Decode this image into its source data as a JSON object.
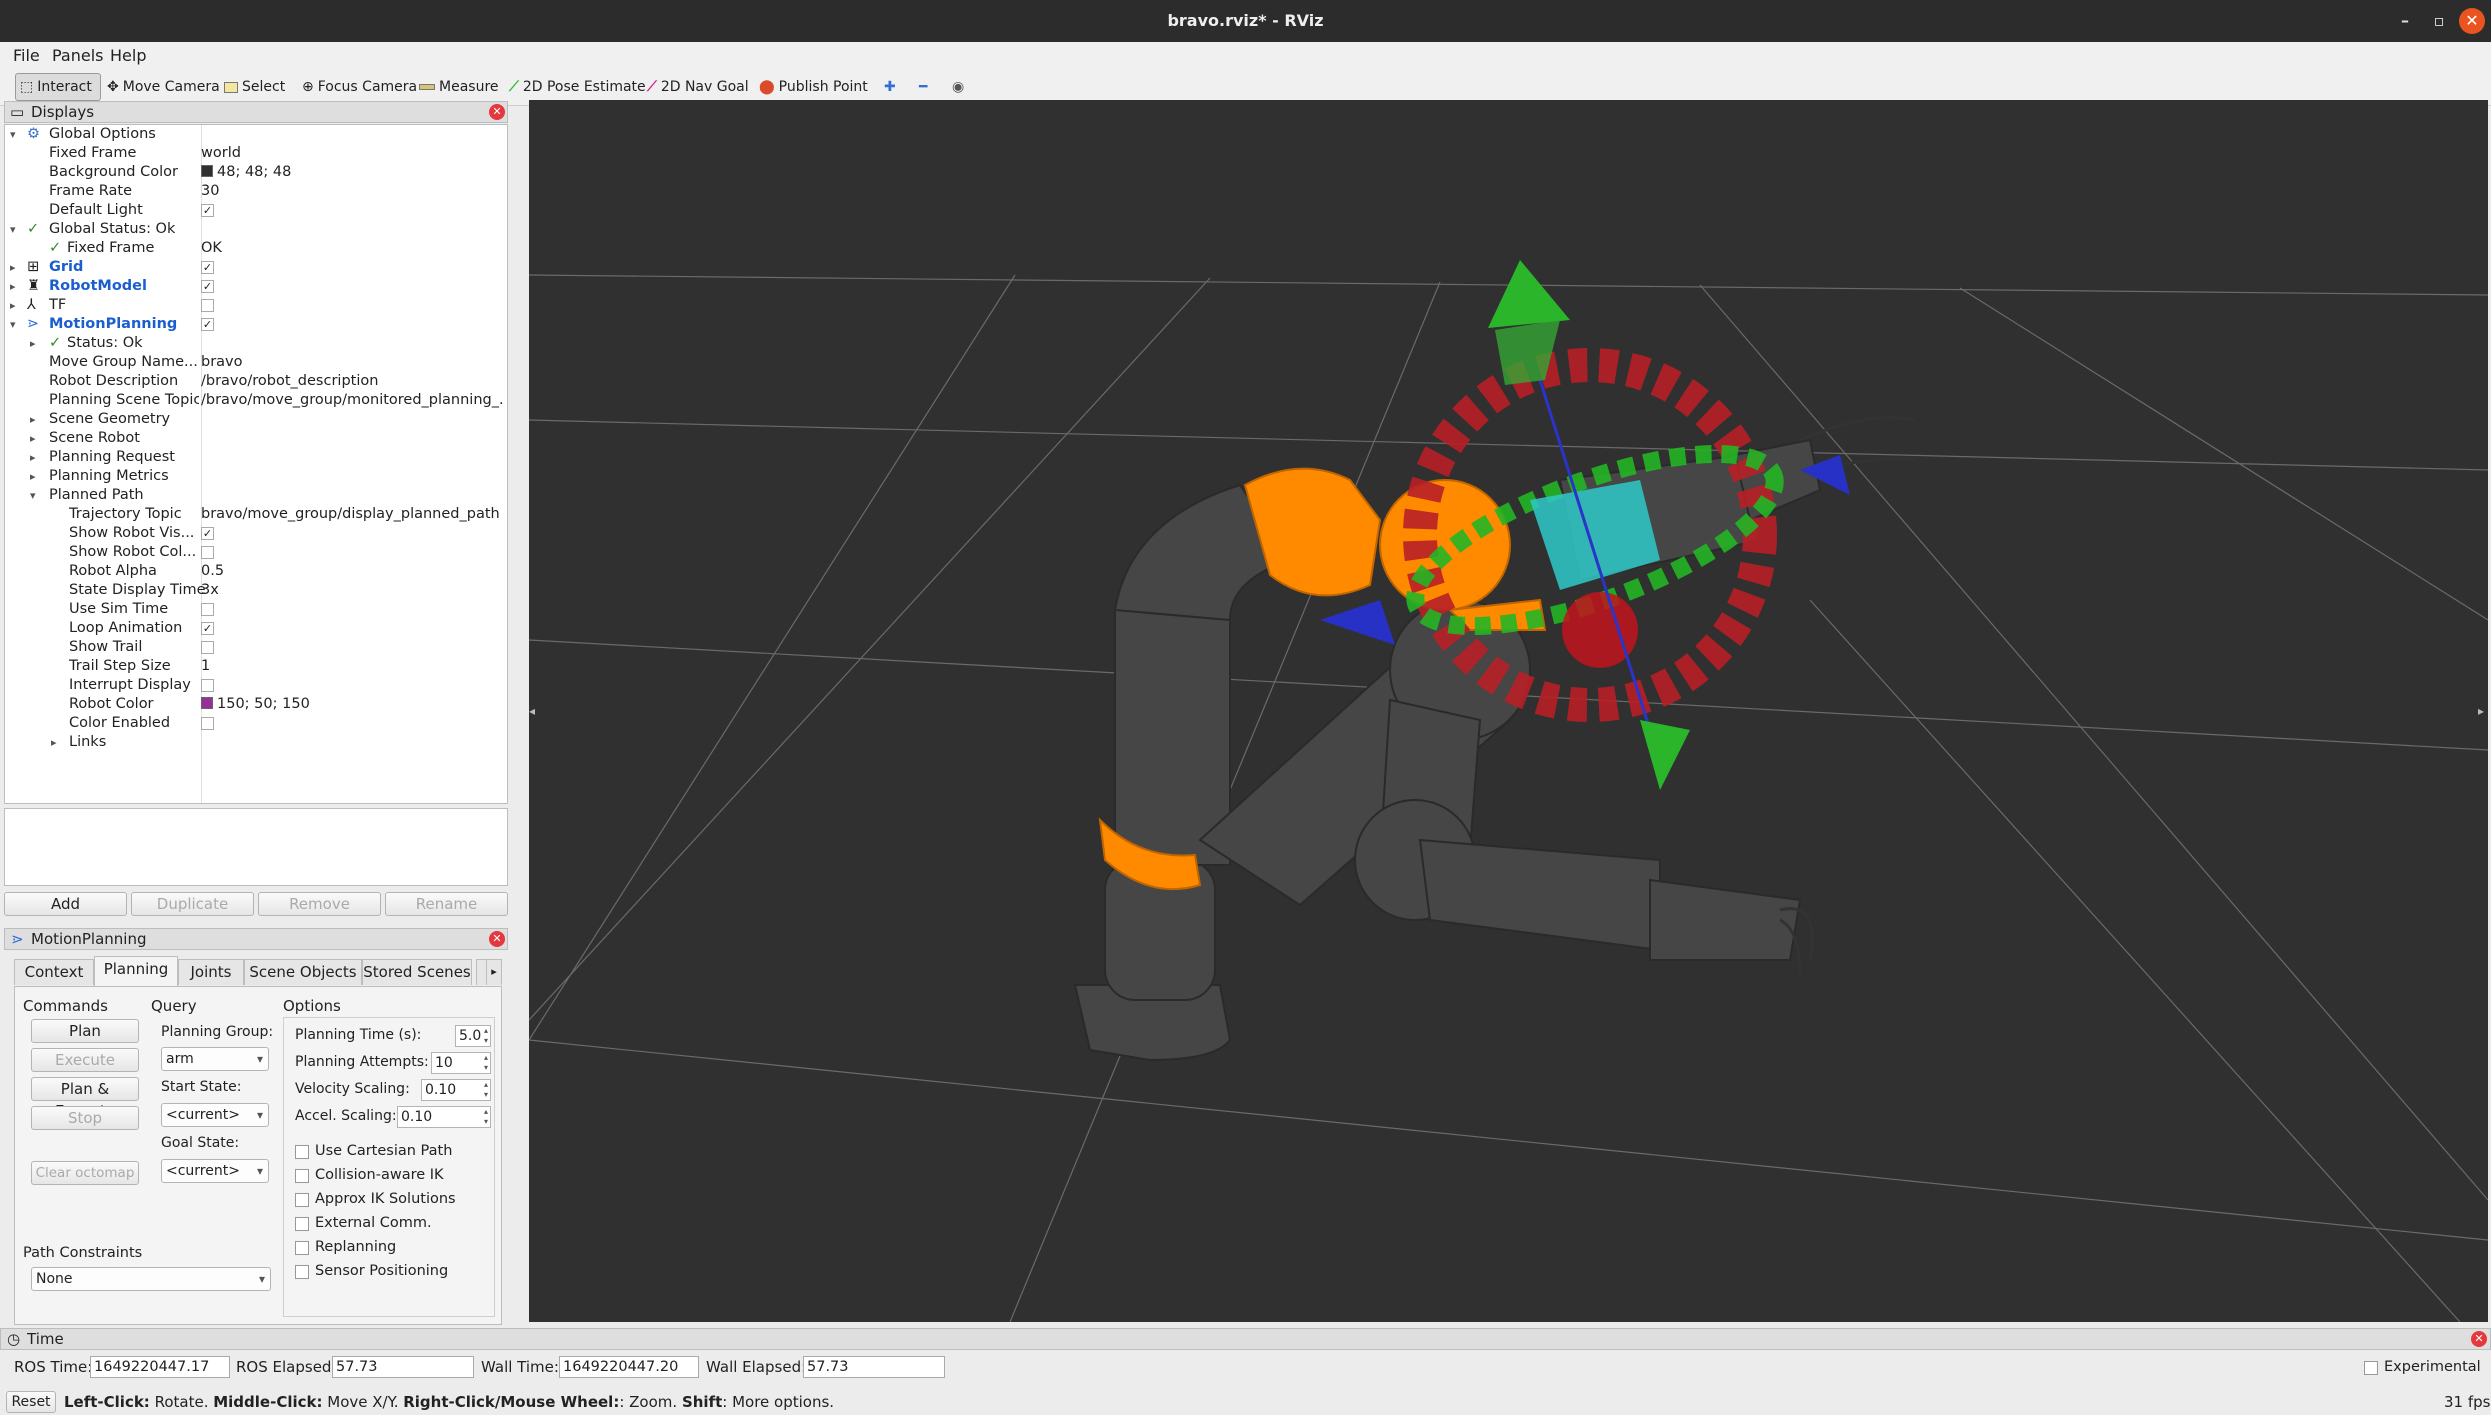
{
  "window": {
    "title": "bravo.rviz* - RViz",
    "min": "–",
    "max": "▫",
    "close": "✕"
  },
  "menu": [
    "File",
    "Panels",
    "Help"
  ],
  "toolbar": {
    "interact": "Interact",
    "move_camera": "Move Camera",
    "select": "Select",
    "focus_camera": "Focus Camera",
    "measure": "Measure",
    "pose_estimate": "2D Pose Estimate",
    "nav_goal": "2D Nav Goal",
    "publish_point": "Publish Point"
  },
  "displays": {
    "title": "Displays",
    "global_options": "Global Options",
    "fixed_frame_label": "Fixed Frame",
    "fixed_frame": "world",
    "bg_color_label": "Background Color",
    "bg_color": "48; 48; 48",
    "frame_rate_label": "Frame Rate",
    "frame_rate": "30",
    "default_light_label": "Default Light",
    "global_status": "Global Status: Ok",
    "status_fixed_frame_label": "Fixed Frame",
    "status_fixed_frame": "OK",
    "grid": "Grid",
    "robot_model": "RobotModel",
    "tf": "TF",
    "motion_planning": "MotionPlanning",
    "mp_status": "Status: Ok",
    "move_group_label": "Move Group Name...",
    "move_group": "bravo",
    "robot_desc_label": "Robot Description",
    "robot_desc": "/bravo/robot_description",
    "scene_topic_label": "Planning Scene Topic",
    "scene_topic": "/bravo/move_group/monitored_planning_...",
    "scene_geometry": "Scene Geometry",
    "scene_robot": "Scene Robot",
    "planning_request": "Planning Request",
    "planning_metrics": "Planning Metrics",
    "planned_path": "Planned Path",
    "traj_topic_label": "Trajectory Topic",
    "traj_topic": "bravo/move_group/display_planned_path",
    "show_robot_vis": "Show Robot Vis...",
    "show_robot_col": "Show Robot Col...",
    "robot_alpha_label": "Robot Alpha",
    "robot_alpha": "0.5",
    "state_display_label": "State Display Time",
    "state_display": "3x",
    "use_sim_time": "Use Sim Time",
    "loop_animation": "Loop Animation",
    "show_trail": "Show Trail",
    "trail_step_label": "Trail Step Size",
    "trail_step": "1",
    "interrupt_display": "Interrupt Display",
    "robot_color_label": "Robot Color",
    "robot_color": "150; 50; 150",
    "color_enabled": "Color Enabled",
    "links": "Links",
    "buttons": {
      "add": "Add",
      "duplicate": "Duplicate",
      "remove": "Remove",
      "rename": "Rename"
    }
  },
  "motion_planning": {
    "title": "MotionPlanning",
    "tabs": [
      "Context",
      "Planning",
      "Joints",
      "Scene Objects",
      "Stored Scenes"
    ],
    "commands": "Commands",
    "query": "Query",
    "options": "Options",
    "plan": "Plan",
    "execute": "Execute",
    "plan_execute": "Plan & Execute",
    "stop": "Stop",
    "clear_octomap": "Clear octomap",
    "planning_group_label": "Planning Group:",
    "planning_group": "arm",
    "start_state_label": "Start State:",
    "start_state": "<current>",
    "goal_state_label": "Goal State:",
    "goal_state": "<current>",
    "planning_time_label": "Planning Time (s):",
    "planning_time": "5.0",
    "planning_attempts_label": "Planning Attempts:",
    "planning_attempts": "10",
    "velocity_label": "Velocity Scaling:",
    "velocity": "0.10",
    "accel_label": "Accel. Scaling:",
    "accel": "0.10",
    "opts": [
      "Use Cartesian Path",
      "Collision-aware IK",
      "Approx IK Solutions",
      "External Comm.",
      "Replanning",
      "Sensor Positioning"
    ],
    "path_constraints_label": "Path Constraints",
    "path_constraints": "None"
  },
  "time": {
    "title": "Time",
    "ros_time_label": "ROS Time:",
    "ros_time": "1649220447.17",
    "ros_elapsed_label": "ROS Elapsed:",
    "ros_elapsed": "57.73",
    "wall_time_label": "Wall Time:",
    "wall_time": "1649220447.20",
    "wall_elapsed_label": "Wall Elapsed:",
    "wall_elapsed": "57.73",
    "experimental": "Experimental"
  },
  "status": {
    "reset": "Reset",
    "left_click": "Left-Click:",
    "left_action": " Rotate. ",
    "middle_click": "Middle-Click:",
    "middle_action": " Move X/Y. ",
    "right_click": "Right-Click/Mouse Wheel:",
    "right_action": ": Zoom. ",
    "shift": "Shift",
    "shift_action": ": More options.",
    "fps": "31 fps"
  },
  "colors": {
    "bg": "#303030",
    "arm_gray": "#4a4a4a",
    "orange": "#ff8a00",
    "marker_red": "#c0202a",
    "marker_green": "#2bbd2b",
    "cyan": "#2ec9c9"
  }
}
